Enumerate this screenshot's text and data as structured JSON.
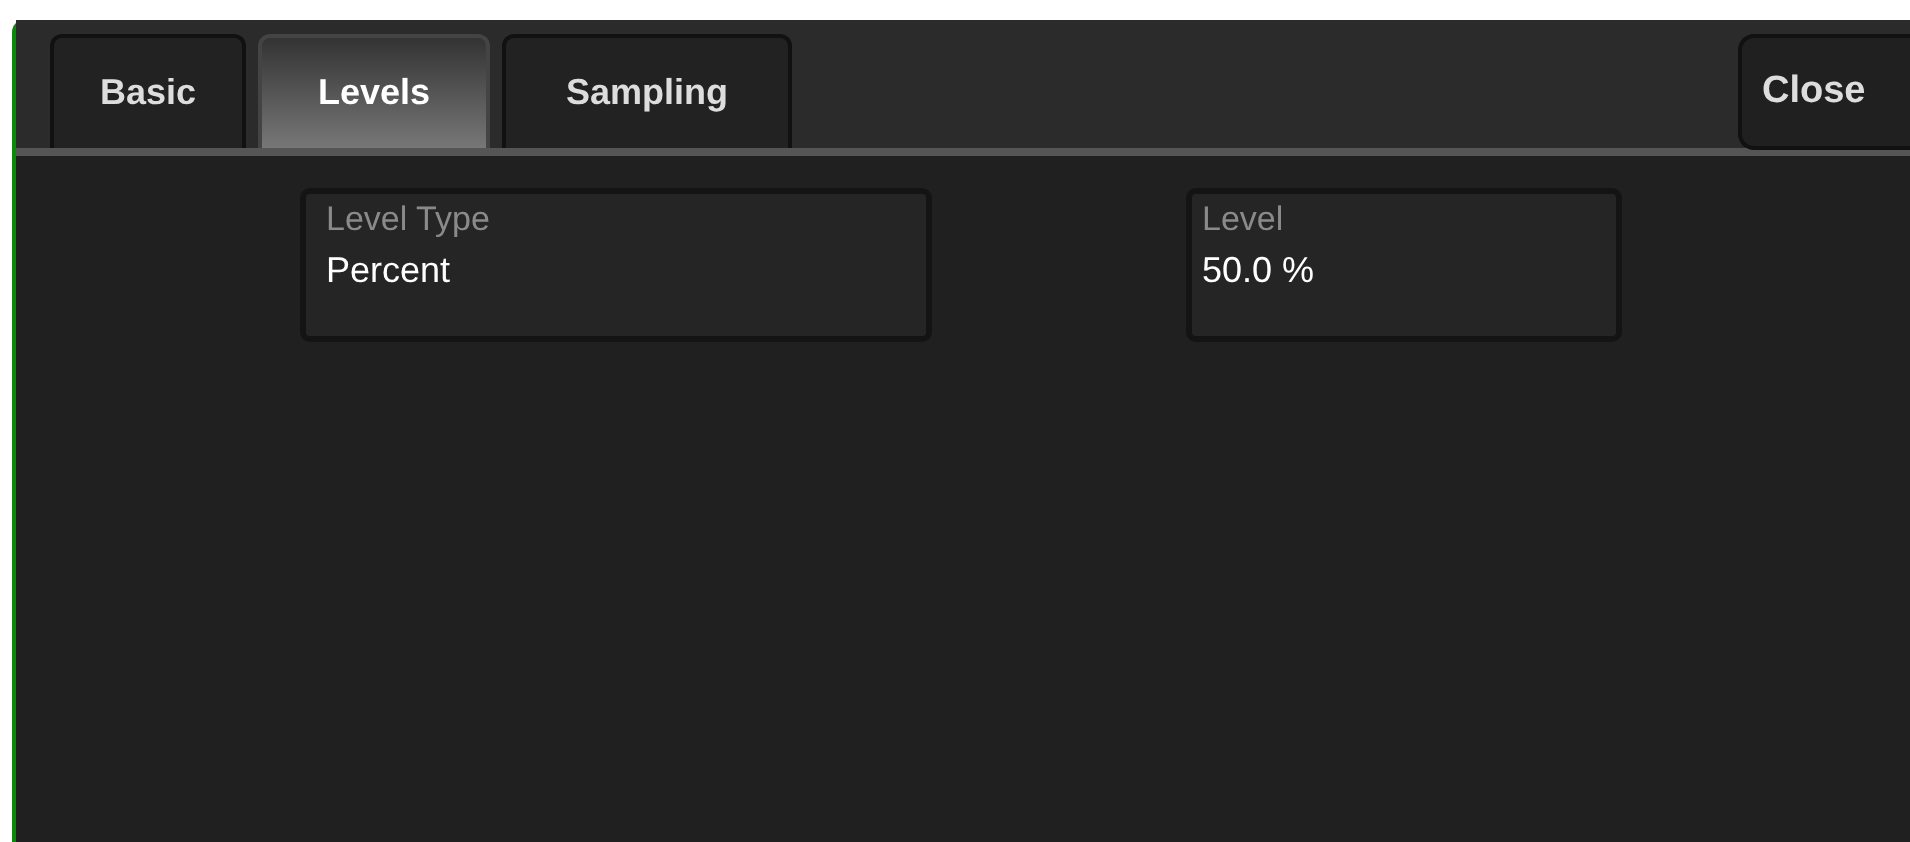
{
  "tabs": [
    {
      "label": "Basic",
      "selected": false
    },
    {
      "label": "Levels",
      "selected": true
    },
    {
      "label": "Sampling",
      "selected": false
    }
  ],
  "close_button": "Close",
  "fields": [
    {
      "label": "Level Type",
      "value": "Percent"
    },
    {
      "label": "Level",
      "value": "50.0 %"
    }
  ]
}
